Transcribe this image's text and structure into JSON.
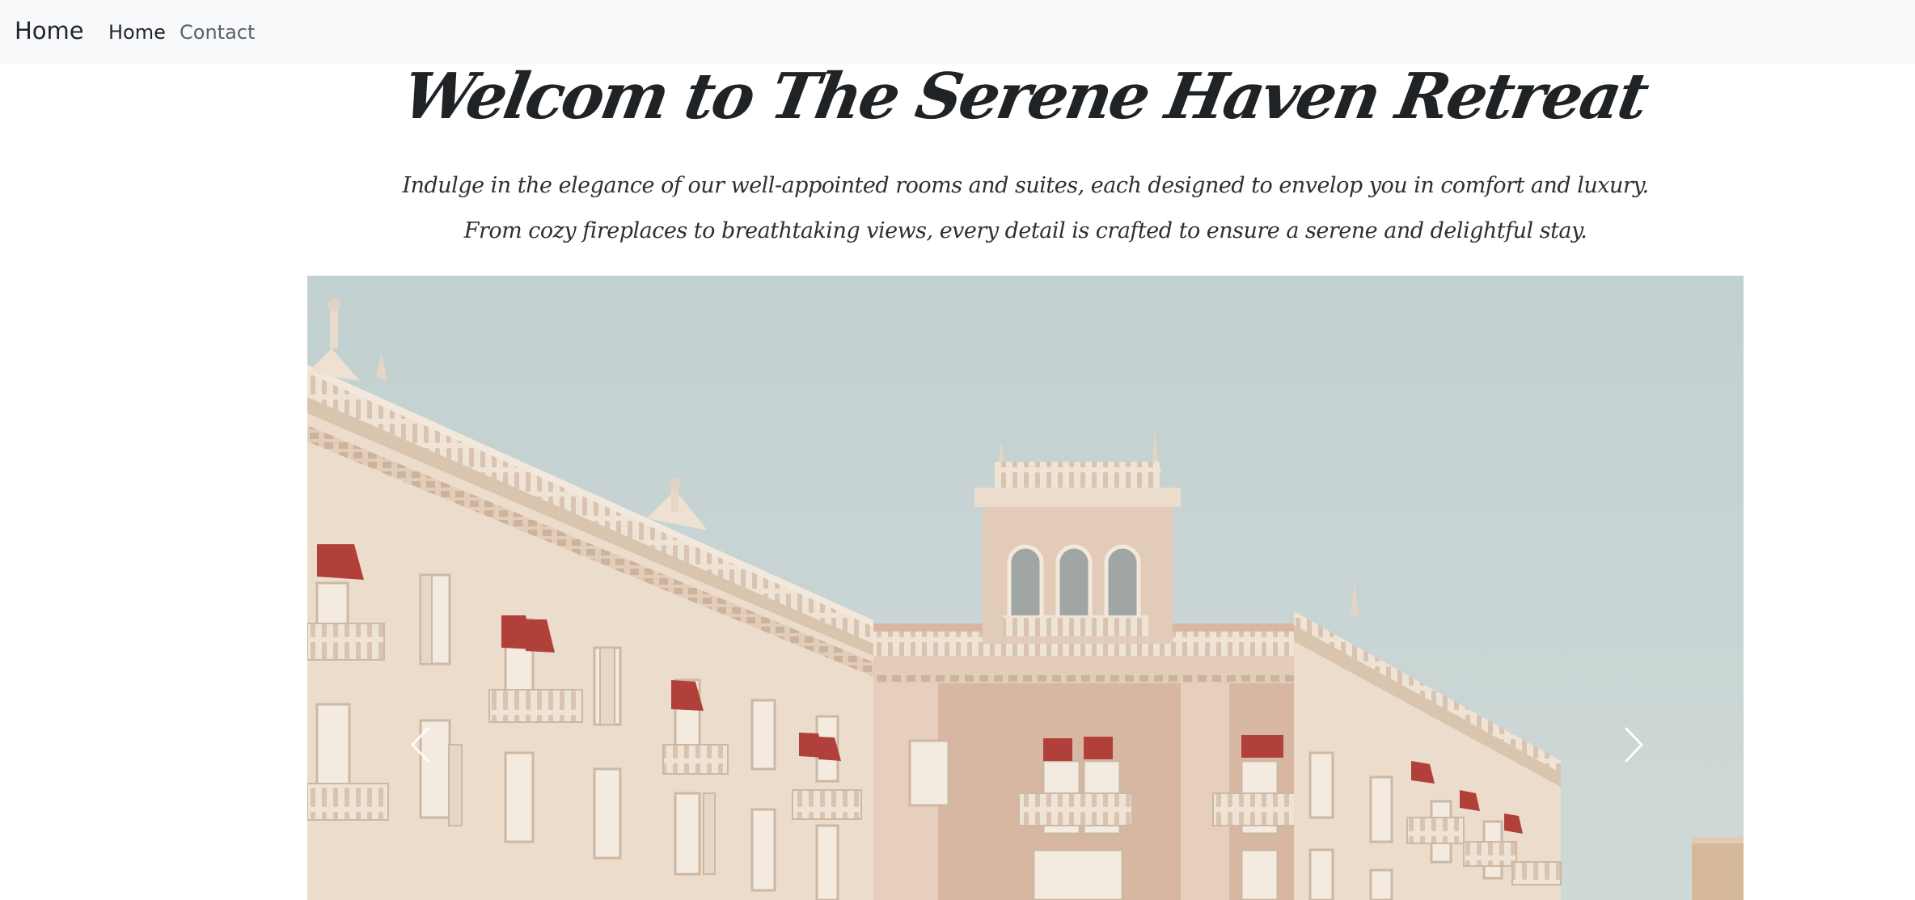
{
  "navbar": {
    "brand": "Home",
    "links": [
      {
        "label": "Home"
      },
      {
        "label": "Contact"
      }
    ]
  },
  "hero": {
    "title": "Welcom to The Serene Haven Retreat",
    "subtitle_line1": "Indulge in the elegance of our well-appointed rooms and suites, each designed to envelop you in comfort and luxury.",
    "subtitle_line2": "From cozy fireplaces to breathtaking views, every detail is crafted to ensure a serene and delightful stay."
  },
  "carousel": {
    "prev_icon": "chevron-left-icon",
    "next_icon": "chevron-right-icon",
    "colors": {
      "sky": "#c3d1d1",
      "building": "#ead9c8",
      "building_shade": "#d7b8a3",
      "awning": "#b2403a"
    }
  }
}
